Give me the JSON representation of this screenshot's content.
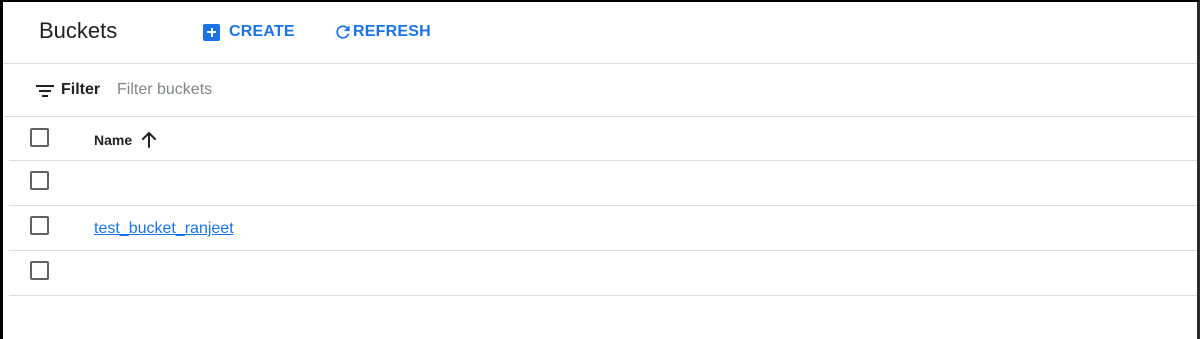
{
  "header": {
    "title": "Buckets",
    "create_label": "CREATE",
    "refresh_label": "REFRESH"
  },
  "filter": {
    "label": "Filter",
    "placeholder": "Filter buckets",
    "value": ""
  },
  "table": {
    "columns": [
      {
        "label": "Name",
        "sort": "ascending"
      }
    ],
    "rows": [
      {
        "name": ""
      },
      {
        "name": "test_bucket_ranjeet"
      },
      {
        "name": ""
      }
    ]
  },
  "colors": {
    "accent": "#1a73e8",
    "text": "#202124",
    "muted": "#80868b",
    "divider": "#dadce0"
  },
  "icons": {
    "create": "add-box-icon",
    "refresh": "refresh-icon",
    "filter": "filter-list-icon",
    "sort": "arrow-up-icon"
  }
}
